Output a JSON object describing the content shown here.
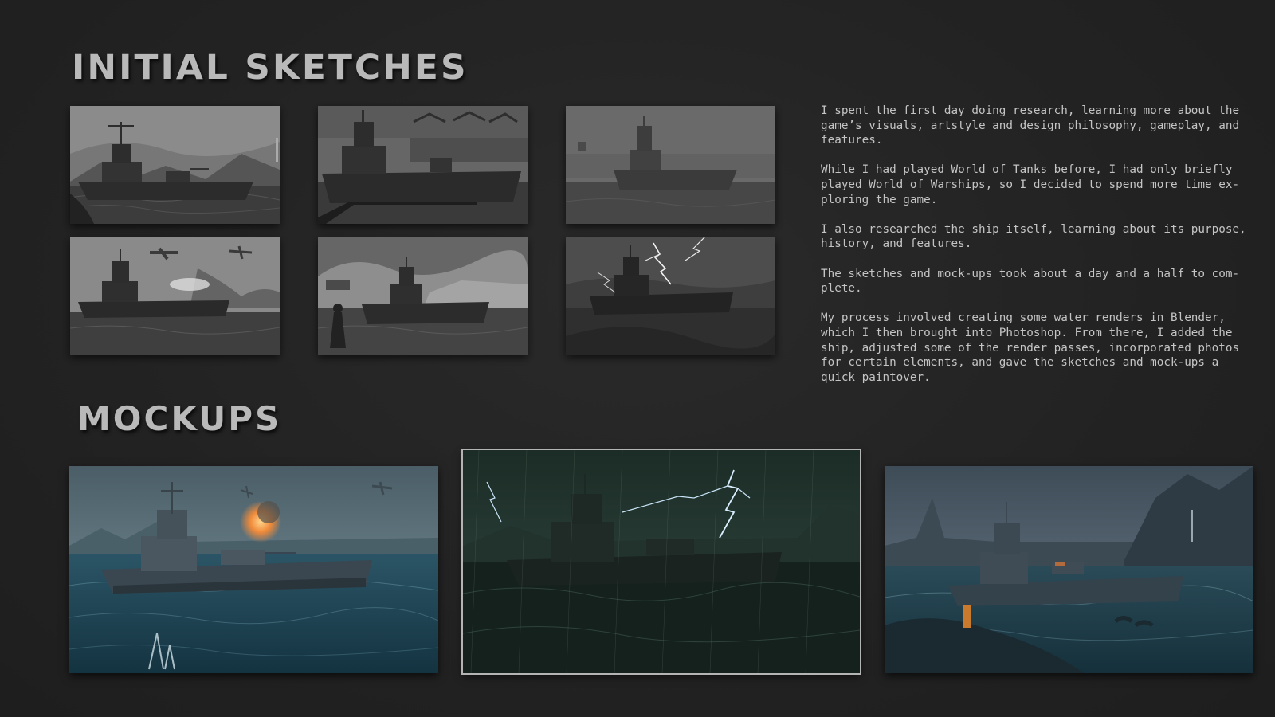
{
  "headings": {
    "sketches": "INITIAL SKETCHES",
    "mockups": "MOCKUPS"
  },
  "description": [
    "I spent the first day doing research, learning more about the\ngame’s visuals, artstyle and design philosophy, gameplay, and\nfeatures.",
    "While I had played World of Tanks before, I had only briefly\nplayed World of Warships, so I decided to spend more time ex-\nploring the game.",
    "I also researched the ship itself, learning about its purpose,\nhistory, and features.",
    "The sketches and mock-ups took about a day and a half to com-\nplete.",
    "My process involved creating some water renders in Blender,\nwhich I then brought into Photoshop. From there, I added the\nship, adjusted some of the render passes, incorporated photos\nfor certain elements, and gave the sketches and mock-ups a\nquick paintover."
  ],
  "sketches": [
    {
      "name": "sketch-cruiser-coast",
      "sky": "#7a7a7a",
      "sea": "#3e3e3e"
    },
    {
      "name": "sketch-cruiser-harbor",
      "sky": "#6a6a6a",
      "sea": "#3a3a3a"
    },
    {
      "name": "sketch-cruiser-fog",
      "sky": "#6c6c6c",
      "sea": "#454545"
    },
    {
      "name": "sketch-cruiser-aircraft",
      "sky": "#8a8a8a",
      "sea": "#3f3f3f"
    },
    {
      "name": "sketch-cruiser-buoy",
      "sky": "#8e8e8e",
      "sea": "#444444"
    },
    {
      "name": "sketch-cruiser-lightning",
      "sky": "#3c3c3c",
      "sea": "#2c2c2c"
    }
  ],
  "mockups": [
    {
      "name": "mockup-cruiser-battle",
      "sky": "#5a7480",
      "sea": "#1f4150"
    },
    {
      "name": "mockup-cruiser-storm",
      "sky": "#23372f",
      "sea": "#172420"
    },
    {
      "name": "mockup-cruiser-fjord",
      "sky": "#52616e",
      "sea": "#1e3a46"
    }
  ],
  "colors": {
    "background": "#232323",
    "heading": "#b9b9b9",
    "body_text": "#c4c4c4"
  }
}
